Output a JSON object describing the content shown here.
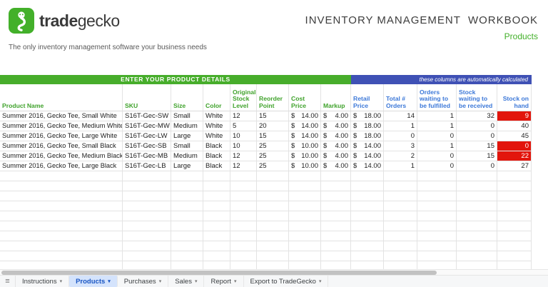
{
  "brand": {
    "name_bold": "trade",
    "name_light": "gecko",
    "tagline": "The only inventory management software your business needs",
    "green": "#43b02a"
  },
  "header": {
    "title": "INVENTORY MANAGEMENT  WORKBOOK",
    "subtitle": "Products"
  },
  "banners": {
    "manual": "ENTER YOUR PRODUCT DETAILS",
    "auto": "these columns are automatically calculated",
    "manual_color": "#47ad2b",
    "auto_color": "#3f51b5"
  },
  "table": {
    "headers": [
      "Product Name",
      "SKU",
      "Size",
      "Color",
      "Original Stock Level",
      "Reorder Point",
      "Cost Price",
      "Markup",
      "Retail Price",
      "Total # Orders",
      "Orders waiting to be fulfilled",
      "Stock waiting to be received",
      "Stock on hand"
    ],
    "alert_color": "#e2150c",
    "rows": [
      {
        "alert": true,
        "cells": [
          "Summer 2016, Gecko Tee, Small White",
          "S16T-Gec-SW",
          "Small",
          "White",
          "12",
          "15",
          {
            "c": "$",
            "v": "14.00"
          },
          {
            "c": "$",
            "v": "4.00"
          },
          {
            "c": "$",
            "v": "18.00"
          },
          "14",
          "1",
          "32",
          "9"
        ]
      },
      {
        "alert": false,
        "cells": [
          "Summer 2016, Gecko Tee, Medium White",
          "S16T-Gec-MW",
          "Medium",
          "White",
          "5",
          "20",
          {
            "c": "$",
            "v": "14.00"
          },
          {
            "c": "$",
            "v": "4.00"
          },
          {
            "c": "$",
            "v": "18.00"
          },
          "1",
          "1",
          "0",
          "40"
        ]
      },
      {
        "alert": false,
        "cells": [
          "Summer 2016, Gecko Tee, Large White",
          "S16T-Gec-LW",
          "Large",
          "White",
          "10",
          "15",
          {
            "c": "$",
            "v": "14.00"
          },
          {
            "c": "$",
            "v": "4.00"
          },
          {
            "c": "$",
            "v": "18.00"
          },
          "0",
          "0",
          "0",
          "45"
        ]
      },
      {
        "alert": true,
        "cells": [
          "Summer 2016, Gecko Tee, Small Black",
          "S16T-Gec-SB",
          "Small",
          "Black",
          "10",
          "25",
          {
            "c": "$",
            "v": "10.00"
          },
          {
            "c": "$",
            "v": "4.00"
          },
          {
            "c": "$",
            "v": "14.00"
          },
          "3",
          "1",
          "15",
          "0"
        ]
      },
      {
        "alert": true,
        "cells": [
          "Summer 2016, Gecko Tee, Medium Black",
          "S16T-Gec-MB",
          "Medium",
          "Black",
          "12",
          "25",
          {
            "c": "$",
            "v": "10.00"
          },
          {
            "c": "$",
            "v": "4.00"
          },
          {
            "c": "$",
            "v": "14.00"
          },
          "2",
          "0",
          "15",
          "22"
        ]
      },
      {
        "alert": false,
        "cells": [
          "Summer 2016, Gecko Tee, Large Black",
          "S16T-Gec-LB",
          "Large",
          "Black",
          "12",
          "25",
          {
            "c": "$",
            "v": "10.00"
          },
          {
            "c": "$",
            "v": "4.00"
          },
          {
            "c": "$",
            "v": "14.00"
          },
          "1",
          "0",
          "0",
          "27"
        ]
      }
    ]
  },
  "sheet_tabs": {
    "items": [
      "Instructions",
      "Products",
      "Purchases",
      "Sales",
      "Report",
      "Export to TradeGecko"
    ],
    "active": "Products",
    "arrow": "▾",
    "sheets_icon": "≡"
  }
}
